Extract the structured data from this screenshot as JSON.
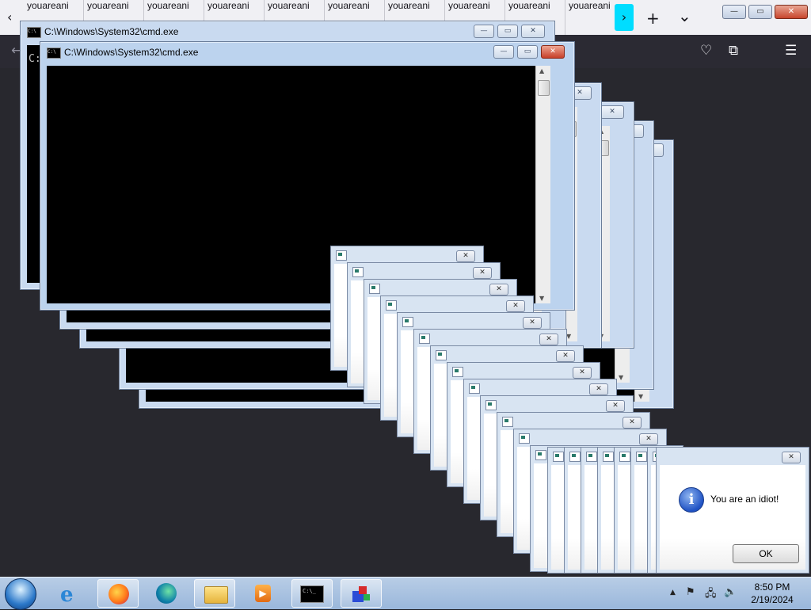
{
  "browser": {
    "tab_label": "youareani",
    "last_tab_label": "youareani",
    "tabs_repeat": 10,
    "new_tab": "+",
    "tab_list": "⌄",
    "scroll_left": "‹",
    "scroll_right": "›"
  },
  "windows": {
    "cmd_title": "C:\\Windows\\System32\\cmd.exe",
    "prompt_text": "C:",
    "minimize": "—",
    "maximize": "▭",
    "close": "✕"
  },
  "dialog": {
    "message": "You are an idiot!",
    "ok_label": "OK",
    "info_glyph": "i",
    "close_glyph": "✕"
  },
  "taskbar": {
    "time": "8:50 PM",
    "date": "2/19/2024",
    "apps": [
      "start-orb",
      "internet-explorer",
      "firefox",
      "edge",
      "file-explorer",
      "media-player",
      "cmd",
      "paint"
    ]
  },
  "colors": {
    "tab_scroll_accent": "#00ddff",
    "browser_nav": "#2b2a33",
    "desktop": "#1f1f24"
  }
}
